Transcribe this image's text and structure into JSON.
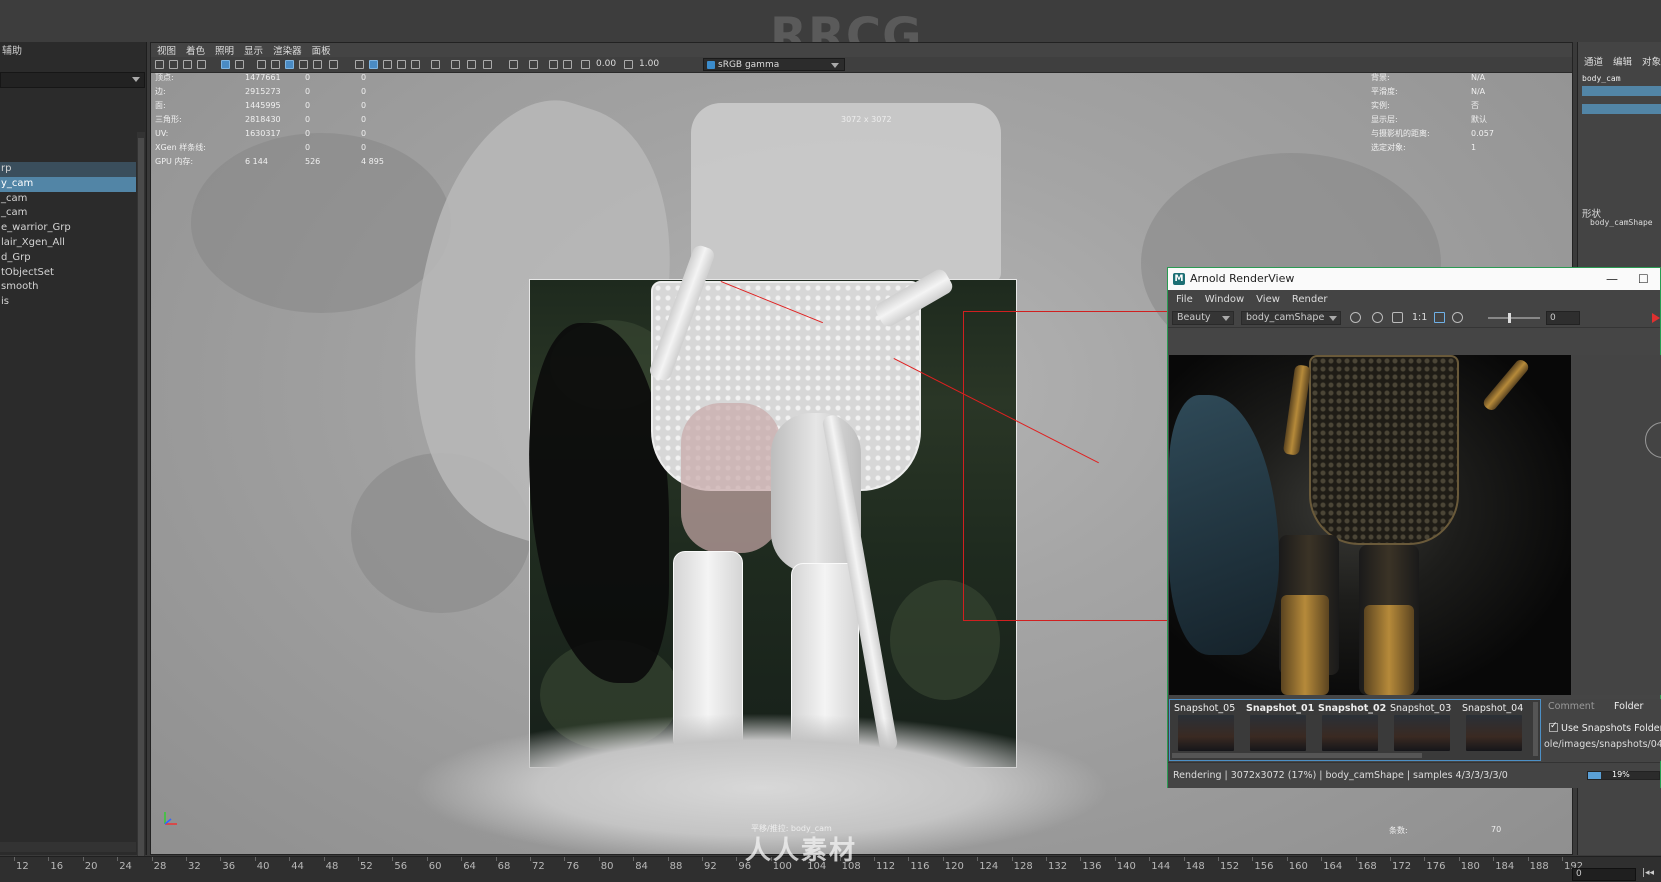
{
  "watermark_top": "RRCG",
  "watermark_bottom": "人人素材",
  "outliner": {
    "header": "辅助",
    "items": [
      {
        "label": "rp",
        "state": "hl"
      },
      {
        "label": "y_cam",
        "state": "sel"
      },
      {
        "label": "_cam",
        "state": ""
      },
      {
        "label": "_cam",
        "state": ""
      },
      {
        "label": "e_warrior_Grp",
        "state": ""
      },
      {
        "label": "lair_Xgen_All",
        "state": ""
      },
      {
        "label": "d_Grp",
        "state": ""
      },
      {
        "label": "tObjectSet",
        "state": ""
      },
      {
        "label": "smooth",
        "state": ""
      },
      {
        "label": "is",
        "state": ""
      }
    ]
  },
  "viewport": {
    "menu": [
      "视图",
      "着色",
      "照明",
      "显示",
      "渲染器",
      "面板"
    ],
    "toolbar": {
      "value1": "0.00",
      "value2": "1.00",
      "color_space": "sRGB gamma"
    },
    "resolution": "3072 x 3072",
    "hud_left": [
      {
        "label": "顶点:",
        "a": "1477661",
        "b": "0",
        "c": "0"
      },
      {
        "label": "边:",
        "a": "2915273",
        "b": "0",
        "c": "0"
      },
      {
        "label": "面:",
        "a": "1445995",
        "b": "0",
        "c": "0"
      },
      {
        "label": "三角形:",
        "a": "2818430",
        "b": "0",
        "c": "0"
      },
      {
        "label": "UV:",
        "a": "1630317",
        "b": "0",
        "c": "0"
      },
      {
        "label": "XGen 样条线:",
        "a": "",
        "b": "0",
        "c": "0"
      },
      {
        "label": "GPU 内存:",
        "a": "6 144",
        "b": "526",
        "c": "4 895"
      }
    ],
    "hud_right": [
      {
        "label": "背景:",
        "value": "N/A"
      },
      {
        "label": "平滑度:",
        "value": "N/A"
      },
      {
        "label": "实例:",
        "value": "否"
      },
      {
        "label": "显示层:",
        "value": "默认"
      },
      {
        "label": "与摄影机的距离:",
        "value": "0.057"
      },
      {
        "label": "选定对象:",
        "value": "1"
      }
    ],
    "footer_camera": "平移/推拉: body_cam",
    "footer_fps_label": "条数:",
    "footer_fps_value": "70"
  },
  "attribute_editor": {
    "tabs": [
      "通道",
      "编辑",
      "对象"
    ],
    "node": "body_cam",
    "shape_label": "形状",
    "shape_node": "body_camShape"
  },
  "timeline": {
    "ticks": [
      "12",
      "16",
      "20",
      "24",
      "28",
      "32",
      "36",
      "40",
      "44",
      "48",
      "52",
      "56",
      "60",
      "64",
      "68",
      "72",
      "76",
      "80",
      "84",
      "88",
      "92",
      "96",
      "100",
      "104",
      "108",
      "112",
      "116",
      "120",
      "124",
      "128",
      "132",
      "136",
      "140",
      "144",
      "148",
      "152",
      "156",
      "160",
      "164",
      "168",
      "172",
      "176",
      "180",
      "184",
      "188",
      "192"
    ],
    "frame": "0",
    "step_btn": "|◂◂"
  },
  "render_view": {
    "title": "Arnold RenderView",
    "menu": [
      "File",
      "Window",
      "View",
      "Render"
    ],
    "aov": "Beauty",
    "camera": "body_camShape",
    "ratio": "1:1",
    "exposure": "0",
    "snapshots": [
      {
        "label": "Snapshot_05",
        "bold": false
      },
      {
        "label": "Snapshot_01",
        "bold": true
      },
      {
        "label": "Snapshot_02",
        "bold": true
      },
      {
        "label": "Snapshot_03",
        "bold": false
      },
      {
        "label": "Snapshot_04",
        "bold": false
      }
    ],
    "snap_tabs": [
      "Comment",
      "Folder"
    ],
    "use_snapshots_folder": "Use Snapshots Folder",
    "snapshots_path": "ole/images/snapshots/04",
    "status": "Rendering | 3072x3072 (17%) | body_camShape  | samples 4/3/3/3/3/0",
    "progress_label": "19%",
    "progress": 0.19,
    "colors": {
      "accent": "#5285a6",
      "border": "#2a9b52",
      "progress": "#5aa0d6"
    }
  }
}
